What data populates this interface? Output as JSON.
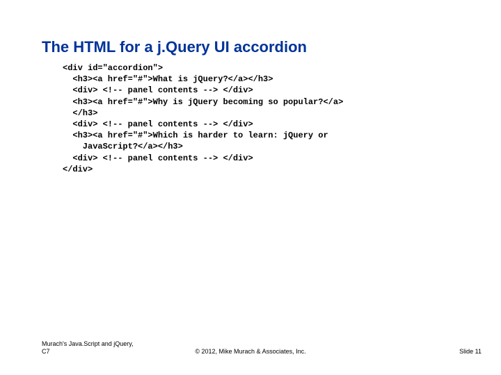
{
  "title": "The HTML for a j.Query UI accordion",
  "code": "<div id=\"accordion\">\n  <h3><a href=\"#\">What is jQuery?</a></h3>\n  <div> <!-- panel contents --> </div>\n  <h3><a href=\"#\">Why is jQuery becoming so popular?</a>\n  </h3>\n  <div> <!-- panel contents --> </div>\n  <h3><a href=\"#\">Which is harder to learn: jQuery or\n    JavaScript?</a></h3>\n  <div> <!-- panel contents --> </div>\n</div>",
  "footer": {
    "left_line1": "Murach's Java.Script and jQuery,",
    "left_line2": "C7",
    "center": "© 2012, Mike Murach & Associates, Inc.",
    "right": "Slide 11"
  }
}
